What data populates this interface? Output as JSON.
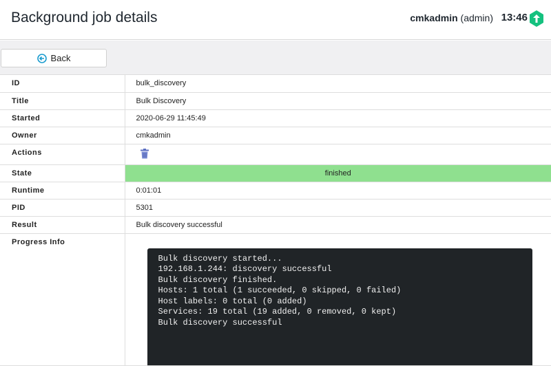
{
  "header": {
    "title": "Background job details",
    "user": "cmkadmin",
    "role": "(admin)",
    "time": "13:46"
  },
  "toolbar": {
    "back_label": "Back"
  },
  "rows": {
    "id": {
      "label": "ID",
      "value": "bulk_discovery"
    },
    "title": {
      "label": "Title",
      "value": "Bulk Discovery"
    },
    "started": {
      "label": "Started",
      "value": "2020-06-29 11:45:49"
    },
    "owner": {
      "label": "Owner",
      "value": "cmkadmin"
    },
    "actions": {
      "label": "Actions"
    },
    "state": {
      "label": "State",
      "value": "finished"
    },
    "runtime": {
      "label": "Runtime",
      "value": "0:01:01"
    },
    "pid": {
      "label": "PID",
      "value": "5301"
    },
    "result": {
      "label": "Result",
      "value": "Bulk discovery successful"
    },
    "progress": {
      "label": "Progress Info",
      "log": "Bulk discovery started...\n192.168.1.244: discovery successful\nBulk discovery finished.\nHosts: 1 total (1 succeeded, 0 skipped, 0 failed)\nHost labels: 0 total (0 added)\nServices: 19 total (19 added, 0 removed, 0 kept)\nBulk discovery successful"
    }
  },
  "colors": {
    "state_finished": "#8fe08f",
    "accent": "#15c17f",
    "terminal_bg": "#202427"
  }
}
